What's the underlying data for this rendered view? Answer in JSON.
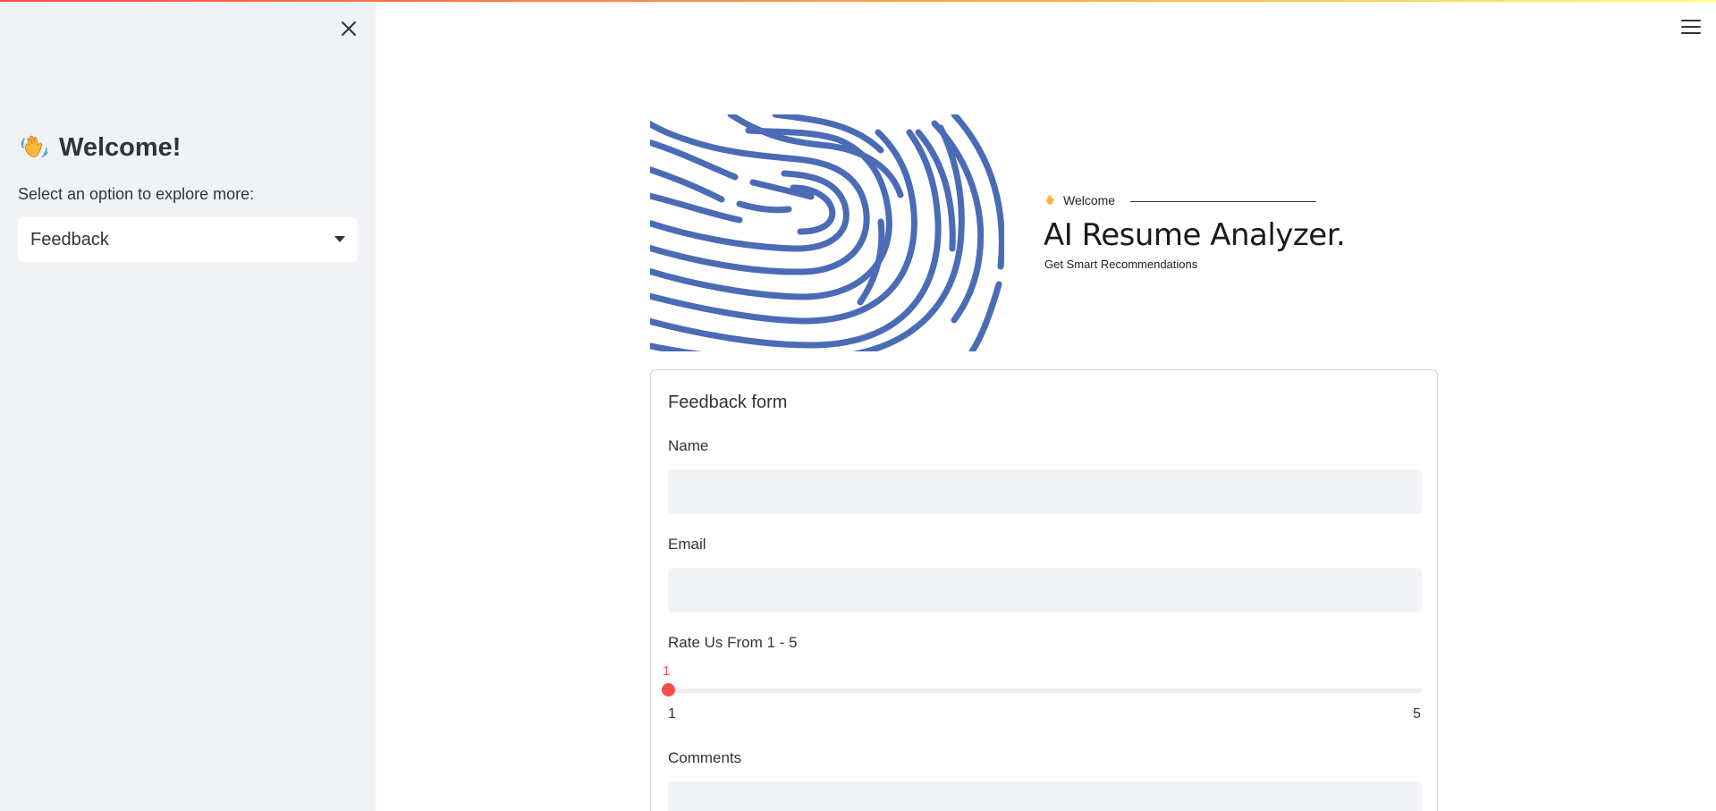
{
  "sidebar": {
    "heading": "Welcome!",
    "heading_icon": "waving-hand-icon",
    "select_label": "Select an option to explore more:",
    "select_value": "Feedback"
  },
  "banner": {
    "welcome": "Welcome",
    "title": "AI Resume Analyzer.",
    "subtitle": "Get Smart Recommendations"
  },
  "form": {
    "title": "Feedback form",
    "name_label": "Name",
    "name_value": "",
    "email_label": "Email",
    "email_value": "",
    "rating_label": "Rate Us From 1 - 5",
    "rating_value": "1",
    "rating_min": "1",
    "rating_max": "5",
    "comments_label": "Comments"
  },
  "colors": {
    "accent": "#ff4b4b",
    "sidebar_bg": "#f0f2f6",
    "fingerprint": "#4a6bb5"
  }
}
